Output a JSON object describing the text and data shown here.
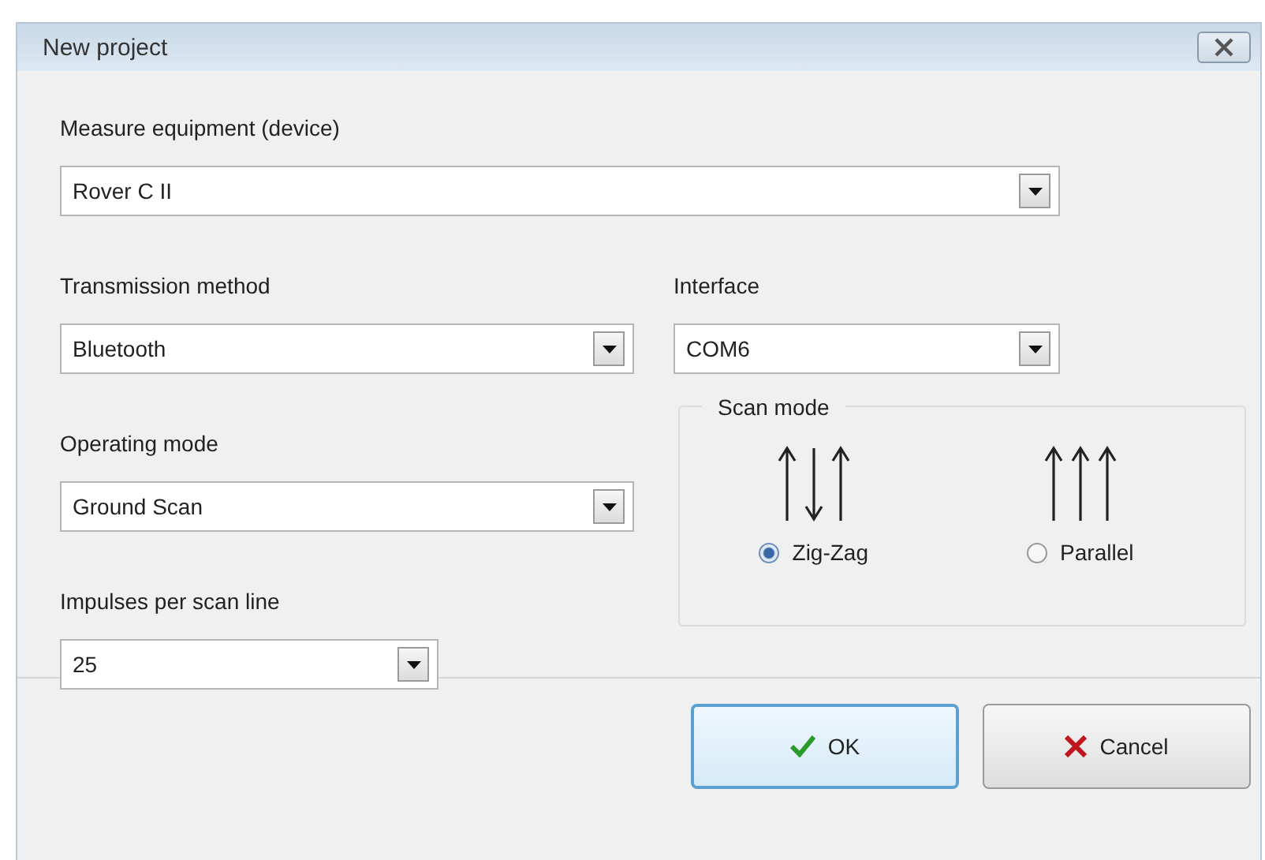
{
  "window": {
    "title": "New project"
  },
  "fields": [
    {
      "label": "Measure equipment (device)",
      "value": "Rover C II"
    },
    {
      "label": "Transmission method",
      "value": "Bluetooth"
    },
    {
      "label": "Interface",
      "value": "COM6"
    },
    {
      "label": "Operating mode",
      "value": "Ground Scan"
    },
    {
      "label": "Impulses per scan line",
      "value": "25"
    }
  ],
  "scan_mode": {
    "legend": "Scan mode",
    "options": [
      {
        "label": "Zig-Zag",
        "kind": "zigzag",
        "selected": true
      },
      {
        "label": "Parallel",
        "kind": "parallel",
        "selected": false
      }
    ]
  },
  "buttons": [
    {
      "label": "OK",
      "kind": "ok"
    },
    {
      "label": "Cancel",
      "kind": "cancel"
    }
  ]
}
